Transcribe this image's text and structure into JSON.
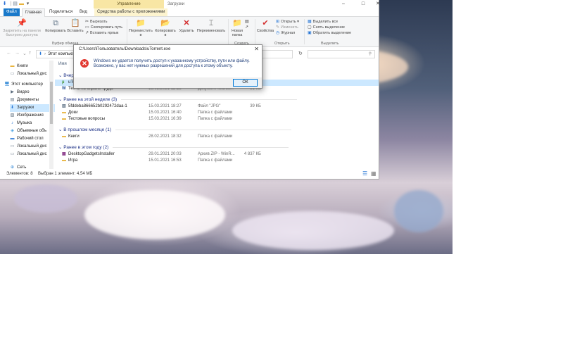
{
  "window": {
    "title": "Загрузки",
    "context_tab_group": "Управление",
    "controls": [
      "–",
      "□",
      "✕"
    ]
  },
  "tabs": [
    "Файл",
    "Главная",
    "Поделиться",
    "Вид",
    "Средства работы с приложениями"
  ],
  "ribbon": {
    "pin_label": "Закрепить на панели быстрого доступа",
    "copy": "Копировать",
    "paste": "Вставить",
    "cut": "Вырезать",
    "copy_path": "Скопировать путь",
    "paste_shortcut": "Вставить ярлык",
    "move_to": "Переместить в",
    "copy_to": "Копировать в",
    "delete": "Удалить",
    "rename": "Переименовать",
    "new_folder": "Новая папка",
    "properties": "Свойства",
    "open": "Открыть",
    "edit": "Изменить",
    "journal": "Журнал",
    "select_all": "Выделить все",
    "select_none": "Снять выделение",
    "invert_selection": "Обратить выделение",
    "group_clipboard": "Буфер обмена",
    "group_create": "Создать",
    "group_open": "Открыть",
    "group_select": "Выделить"
  },
  "address": {
    "path": "Этот компьют",
    "search_placeholder": "",
    "search_icon": "search-icon"
  },
  "nav_pane": [
    {
      "label": "Книги",
      "icon": "folder-icon",
      "color": "#e8b33b"
    },
    {
      "label": "Локальный дис",
      "icon": "drive-icon",
      "color": "#6a7b8c"
    },
    {
      "label": "Этот компьютер",
      "icon": "computer-icon",
      "color": "#3b8ed8"
    },
    {
      "label": "Видео",
      "icon": "video-icon",
      "color": "#5a6b7c"
    },
    {
      "label": "Документы",
      "icon": "documents-icon",
      "color": "#5a6b7c"
    },
    {
      "label": "Загрузки",
      "icon": "downloads-icon",
      "color": "#2a78d6"
    },
    {
      "label": "Изображения",
      "icon": "pictures-icon",
      "color": "#5a6b7c"
    },
    {
      "label": "Музыка",
      "icon": "music-icon",
      "color": "#2a78d6"
    },
    {
      "label": "Объемные объ",
      "icon": "3d-objects-icon",
      "color": "#4aa0e0"
    },
    {
      "label": "Рабочий стол",
      "icon": "desktop-icon",
      "color": "#2a78d6"
    },
    {
      "label": "Локальный дис",
      "icon": "drive-icon",
      "color": "#6a7b8c"
    },
    {
      "label": "Локальный дис",
      "icon": "drive-icon",
      "color": "#6a7b8c"
    },
    {
      "label": "Сеть",
      "icon": "network-icon",
      "color": "#3b8ed8"
    }
  ],
  "file_list": {
    "column_header": "Имя",
    "groups": [
      {
        "title": "Вчера",
        "rows": [
          {
            "name": "uTorrent",
            "date": "",
            "type": "",
            "size": "",
            "icon": "utorrent-icon",
            "selected": true
          },
          {
            "name": "Тесты по охране труда",
            "date": "19.03.2021 12:13",
            "type": "Документ Micros...",
            "size": "31 КБ",
            "icon": "word-icon",
            "selected": false
          }
        ]
      },
      {
        "title": "Ранее на этой неделе (3)",
        "rows": [
          {
            "name": "5fddeba866652b0292472daa-1",
            "date": "15.03.2021 18:27",
            "type": "Файл \"JPG\"",
            "size": "39 КБ",
            "icon": "image-file-icon",
            "selected": false
          },
          {
            "name": "Доки",
            "date": "15.03.2021 16:40",
            "type": "Папка с файлами",
            "size": "",
            "icon": "folder-icon",
            "selected": false
          },
          {
            "name": "Тестовые вопросы",
            "date": "15.03.2021 16:39",
            "type": "Папка с файлами",
            "size": "",
            "icon": "folder-icon",
            "selected": false
          }
        ]
      },
      {
        "title": "В прошлом месяце (1)",
        "rows": [
          {
            "name": "Книги",
            "date": "28.02.2021 18:32",
            "type": "Папка с файлами",
            "size": "",
            "icon": "folder-icon",
            "selected": false
          }
        ]
      },
      {
        "title": "Ранее в этом году (2)",
        "rows": [
          {
            "name": "DesktopGadgetsInstaller",
            "date": "29.01.2021 20:03",
            "type": "Архив ZIP - WinR...",
            "size": "4 837 КБ",
            "icon": "zip-icon",
            "selected": false
          },
          {
            "name": "Игра",
            "date": "15.01.2021 16:53",
            "type": "Папка с файлами",
            "size": "",
            "icon": "folder-icon",
            "selected": false
          }
        ]
      }
    ]
  },
  "status": {
    "count": "Элементов: 8",
    "selected": "Выбран 1 элемент: 4,54 МБ"
  },
  "dialog": {
    "title": "C:\\Users\\Пользователь\\Downloads\\uTorrent.exe",
    "message_line1": "Windows не удается получить доступ к указанному устройству, пути или файлу.",
    "message_line2": "Возможно, у вас нет нужных разрешений для доступа к этому объекту.",
    "ok_label": "ОК",
    "close_glyph": "✕",
    "icon_glyph": "✕"
  },
  "colors": {
    "accent": "#1979ca",
    "selection": "#cce8ff",
    "error": "#e23a32",
    "context_tab": "#f8e6a4"
  }
}
